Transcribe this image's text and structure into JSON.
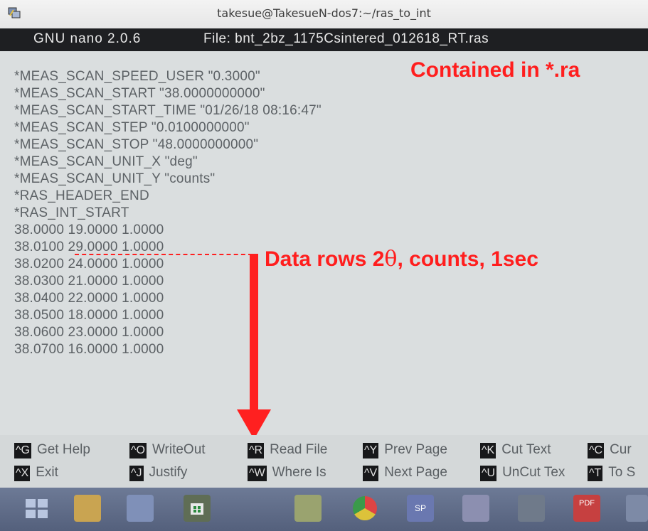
{
  "window": {
    "title": "takesue@TakesueN-dos7:~/ras_to_int"
  },
  "nano_header": {
    "version": "GNU nano 2.0.6",
    "file": "File: bnt_2bz_1175Csintered_012618_RT.ras"
  },
  "lines": [
    "*MEAS_SCAN_SPEED_USER \"0.3000\"",
    "*MEAS_SCAN_START \"38.0000000000\"",
    "*MEAS_SCAN_START_TIME \"01/26/18 08:16:47\"",
    "*MEAS_SCAN_STEP \"0.0100000000\"",
    "*MEAS_SCAN_STOP \"48.0000000000\"",
    "*MEAS_SCAN_UNIT_X \"deg\"",
    "*MEAS_SCAN_UNIT_Y \"counts\"",
    "*RAS_HEADER_END",
    "*RAS_INT_START",
    "38.0000 19.0000 1.0000",
    "38.0100 29.0000 1.0000",
    "38.0200 24.0000 1.0000",
    "38.0300 21.0000 1.0000",
    "38.0400 22.0000 1.0000",
    "38.0500 18.0000 1.0000",
    "38.0600 23.0000 1.0000",
    "38.0700 16.0000 1.0000"
  ],
  "annotations": {
    "contained": "Contained in *.ra",
    "data_rows_prefix": "Data rows 2",
    "theta": "θ",
    "data_rows_suffix": ", counts, 1sec"
  },
  "shortcuts": {
    "row1": [
      {
        "key": "^G",
        "label": "Get Help"
      },
      {
        "key": "^O",
        "label": "WriteOut"
      },
      {
        "key": "^R",
        "label": "Read File"
      },
      {
        "key": "^Y",
        "label": "Prev Page"
      },
      {
        "key": "^K",
        "label": "Cut Text"
      },
      {
        "key": "^C",
        "label": "Cur"
      }
    ],
    "row2": [
      {
        "key": "^X",
        "label": "Exit"
      },
      {
        "key": "^J",
        "label": "Justify"
      },
      {
        "key": "^W",
        "label": "Where Is"
      },
      {
        "key": "^V",
        "label": "Next Page"
      },
      {
        "key": "^U",
        "label": "UnCut Tex"
      },
      {
        "key": "^T",
        "label": "To S"
      }
    ]
  },
  "taskbar": {
    "icons": [
      "windows-start-icon",
      "file-explorer-icon",
      "photos-icon",
      "store-icon",
      "image-viewer-icon",
      "chrome-icon",
      "sp-app-icon",
      "paint-icon",
      "calculator-icon",
      "pdf-icon",
      "app-icon"
    ],
    "pdf_label": "PDF",
    "sp_label": "SP"
  },
  "colors": {
    "annotation": "#ff1e1e",
    "terminal_bg": "#dadedf",
    "terminal_text": "#5d6266",
    "nano_header_bg": "#1e1f22"
  }
}
